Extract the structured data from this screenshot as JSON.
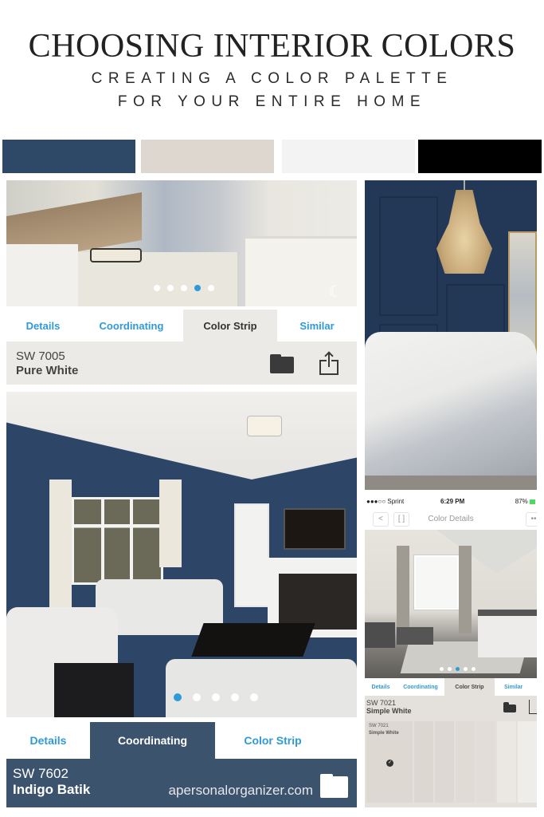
{
  "header": {
    "title": "CHOOSING INTERIOR COLORS",
    "subtitle_line1": "CREATING A COLOR PALETTE",
    "subtitle_line2": "FOR YOUR ENTIRE HOME"
  },
  "palette": [
    {
      "name": "indigo",
      "color": "#2e4868"
    },
    {
      "name": "simple-white-beige",
      "color": "#ddd7cf"
    },
    {
      "name": "pure-white",
      "color": "#f3f3f3"
    },
    {
      "name": "black",
      "color": "#000000"
    }
  ],
  "panel_bathroom": {
    "carousel": {
      "count": 5,
      "active_index": 3
    },
    "icon": "night-mode-moon-icon",
    "tabs": [
      {
        "label": "Details",
        "active": false
      },
      {
        "label": "Coordinating",
        "active": false
      },
      {
        "label": "Color Strip",
        "active": true
      },
      {
        "label": "Similar",
        "active": false
      }
    ],
    "color_code": "SW 7005",
    "color_name": "Pure White",
    "icons": [
      "folder-icon",
      "share-icon"
    ]
  },
  "panel_living": {
    "carousel": {
      "count": 5,
      "active_index": 0
    },
    "tabs": [
      {
        "label": "Details",
        "active": false
      },
      {
        "label": "Coordinating",
        "active": true
      },
      {
        "label": "Color Strip",
        "active": false
      }
    ],
    "color_code": "SW 7602",
    "color_name": "Indigo Batik",
    "watermark": "apersonalorganizer.com",
    "icons": [
      "folder-icon"
    ]
  },
  "phone": {
    "status": {
      "carrier": "●●●○○ Sprint",
      "time": "6:29 PM",
      "battery": "87%"
    },
    "nav": {
      "back": "<",
      "expand": "[ ]",
      "title": "Color Details",
      "more": "••"
    },
    "carousel": {
      "count": 5,
      "active_index": 2
    },
    "tabs": [
      {
        "label": "Details",
        "active": false
      },
      {
        "label": "Coordinating",
        "active": false
      },
      {
        "label": "Color Strip",
        "active": true
      },
      {
        "label": "Similar",
        "active": false
      }
    ],
    "color_code": "SW 7021",
    "color_name": "Simple White",
    "strip": {
      "selected_code": "SW 7021",
      "selected_name": "Simple White",
      "check": "✓"
    }
  }
}
